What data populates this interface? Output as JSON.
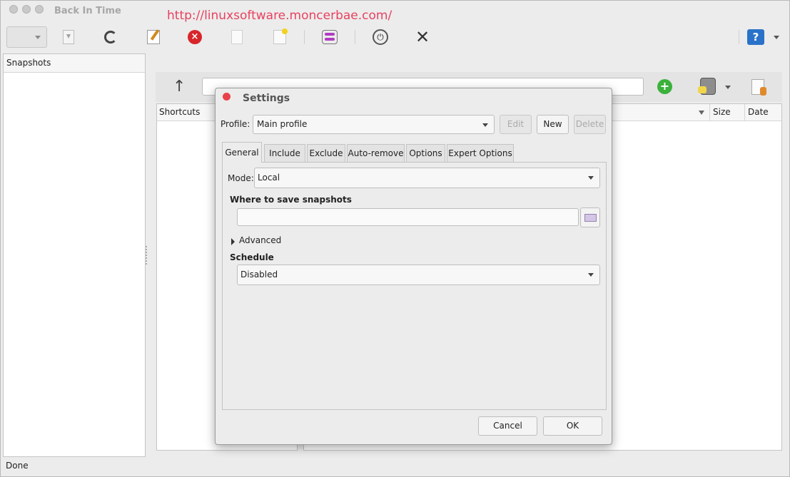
{
  "window": {
    "title": "Back In Time"
  },
  "watermark": "http://linuxsoftware.moncerbae.com/",
  "panels": {
    "snapshots_header": "Snapshots",
    "shortcuts_header": "Shortcuts",
    "files_columns": {
      "size": "Size",
      "date": "Date"
    }
  },
  "statusbar": {
    "text": "Done"
  },
  "toolbar_icons": [
    "restore-icon",
    "refresh-icon",
    "edit-icon",
    "delete-icon",
    "blank-page-icon",
    "new-page-icon",
    "settings-icon",
    "power-icon",
    "close-icon",
    "help-icon"
  ],
  "dialog": {
    "title": "Settings",
    "profile_label": "Profile:",
    "profile_value": "Main profile",
    "buttons": {
      "edit": "Edit",
      "new": "New",
      "delete": "Delete",
      "cancel": "Cancel",
      "ok": "OK"
    },
    "tabs": [
      "General",
      "Include",
      "Exclude",
      "Auto-remove",
      "Options",
      "Expert Options"
    ],
    "active_tab": "General",
    "general": {
      "mode_label": "Mode:",
      "mode_value": "Local",
      "where_label": "Where to save snapshots",
      "where_value": "",
      "advanced_label": "Advanced",
      "schedule_label": "Schedule",
      "schedule_value": "Disabled"
    }
  },
  "colors": {
    "watermark": "#e8415f",
    "delete": "#d7262b",
    "add": "#3bb13b",
    "help": "#2a72c9",
    "dialog_close": "#e8434b"
  }
}
